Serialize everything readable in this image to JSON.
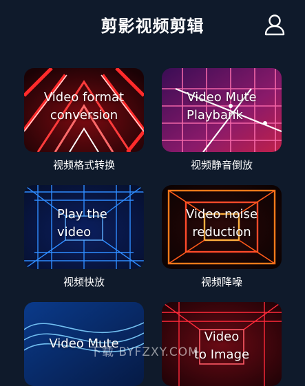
{
  "header": {
    "title": "剪影视频剪辑",
    "profile_icon": "user-icon"
  },
  "cards": [
    {
      "line1": "Video format",
      "line2": "conversion",
      "caption": "视频格式转换"
    },
    {
      "line1": "Video Mute",
      "line2": "Playbank",
      "caption": "视频静音倒放"
    },
    {
      "line1": "Play the",
      "line2": "video",
      "caption": "视频快放"
    },
    {
      "line1": "Video noise",
      "line2": "reduction",
      "caption": "视频降噪"
    },
    {
      "line1": "Video Mute",
      "line2": ""
    },
    {
      "line1": "Video",
      "line2": "to Image"
    }
  ],
  "watermark": "下载 BYFZXY.COM",
  "colors": {
    "background": "#0f1a2b",
    "text": "#ffffff"
  }
}
